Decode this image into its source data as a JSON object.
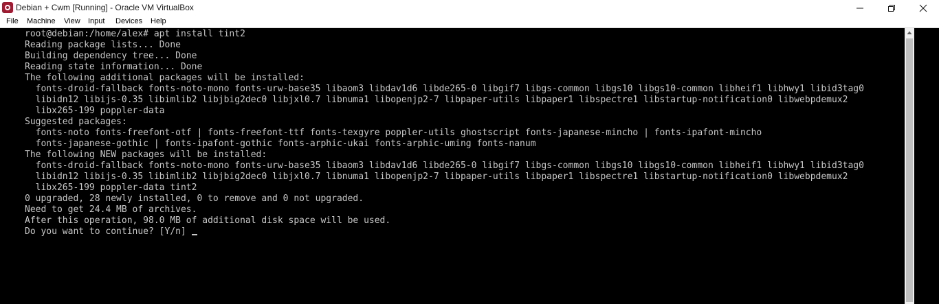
{
  "window": {
    "title": "Debian + Cwm [Running] - Oracle VM VirtualBox"
  },
  "menu": {
    "items": [
      "File",
      "Machine",
      "View",
      "Input",
      "Devices",
      "Help"
    ]
  },
  "terminal": {
    "lines": [
      "root@debian:/home/alex# apt install tint2",
      "Reading package lists... Done",
      "Building dependency tree... Done",
      "Reading state information... Done",
      "The following additional packages will be installed:",
      "  fonts-droid-fallback fonts-noto-mono fonts-urw-base35 libaom3 libdav1d6 libde265-0 libgif7 libgs-common libgs10 libgs10-common libheif1 libhwy1 libid3tag0",
      "  libidn12 libijs-0.35 libimlib2 libjbig2dec0 libjxl0.7 libnuma1 libopenjp2-7 libpaper-utils libpaper1 libspectre1 libstartup-notification0 libwebpdemux2",
      "  libx265-199 poppler-data",
      "Suggested packages:",
      "  fonts-noto fonts-freefont-otf | fonts-freefont-ttf fonts-texgyre poppler-utils ghostscript fonts-japanese-mincho | fonts-ipafont-mincho",
      "  fonts-japanese-gothic | fonts-ipafont-gothic fonts-arphic-ukai fonts-arphic-uming fonts-nanum",
      "The following NEW packages will be installed:",
      "  fonts-droid-fallback fonts-noto-mono fonts-urw-base35 libaom3 libdav1d6 libde265-0 libgif7 libgs-common libgs10 libgs10-common libheif1 libhwy1 libid3tag0",
      "  libidn12 libijs-0.35 libimlib2 libjbig2dec0 libjxl0.7 libnuma1 libopenjp2-7 libpaper-utils libpaper1 libspectre1 libstartup-notification0 libwebpdemux2",
      "  libx265-199 poppler-data tint2",
      "0 upgraded, 28 newly installed, 0 to remove and 0 not upgraded.",
      "Need to get 24.4 MB of archives.",
      "After this operation, 98.0 MB of additional disk space will be used.",
      "Do you want to continue? [Y/n]"
    ]
  },
  "colors": {
    "terminal_background": "#000000",
    "terminal_text": "#c8c8c8",
    "titlebar_background": "#ffffff",
    "app_icon": "#9e1b32"
  },
  "icons": {
    "app": "virtualbox-icon",
    "minimize": "minimize-icon",
    "maximize": "restore-icon",
    "close": "close-icon",
    "scroll_up": "scroll-up-arrow-icon"
  }
}
